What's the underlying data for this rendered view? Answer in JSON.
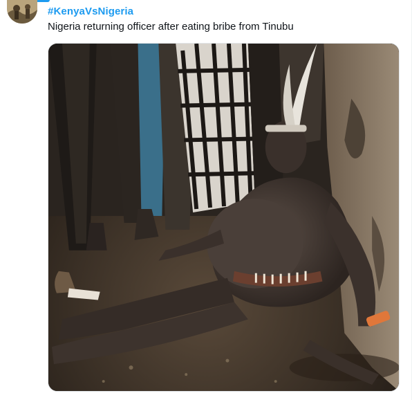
{
  "tweet": {
    "hashtag": "#KenyaVsNigeria",
    "text": "Nigeria returning officer after eating bribe from Tinubu",
    "media_description_icon": "photo-icon"
  },
  "colors": {
    "link": "#1d9bf0",
    "text": "#0f1419",
    "background": "#ffffff",
    "media_border": "#e1e5e8"
  }
}
